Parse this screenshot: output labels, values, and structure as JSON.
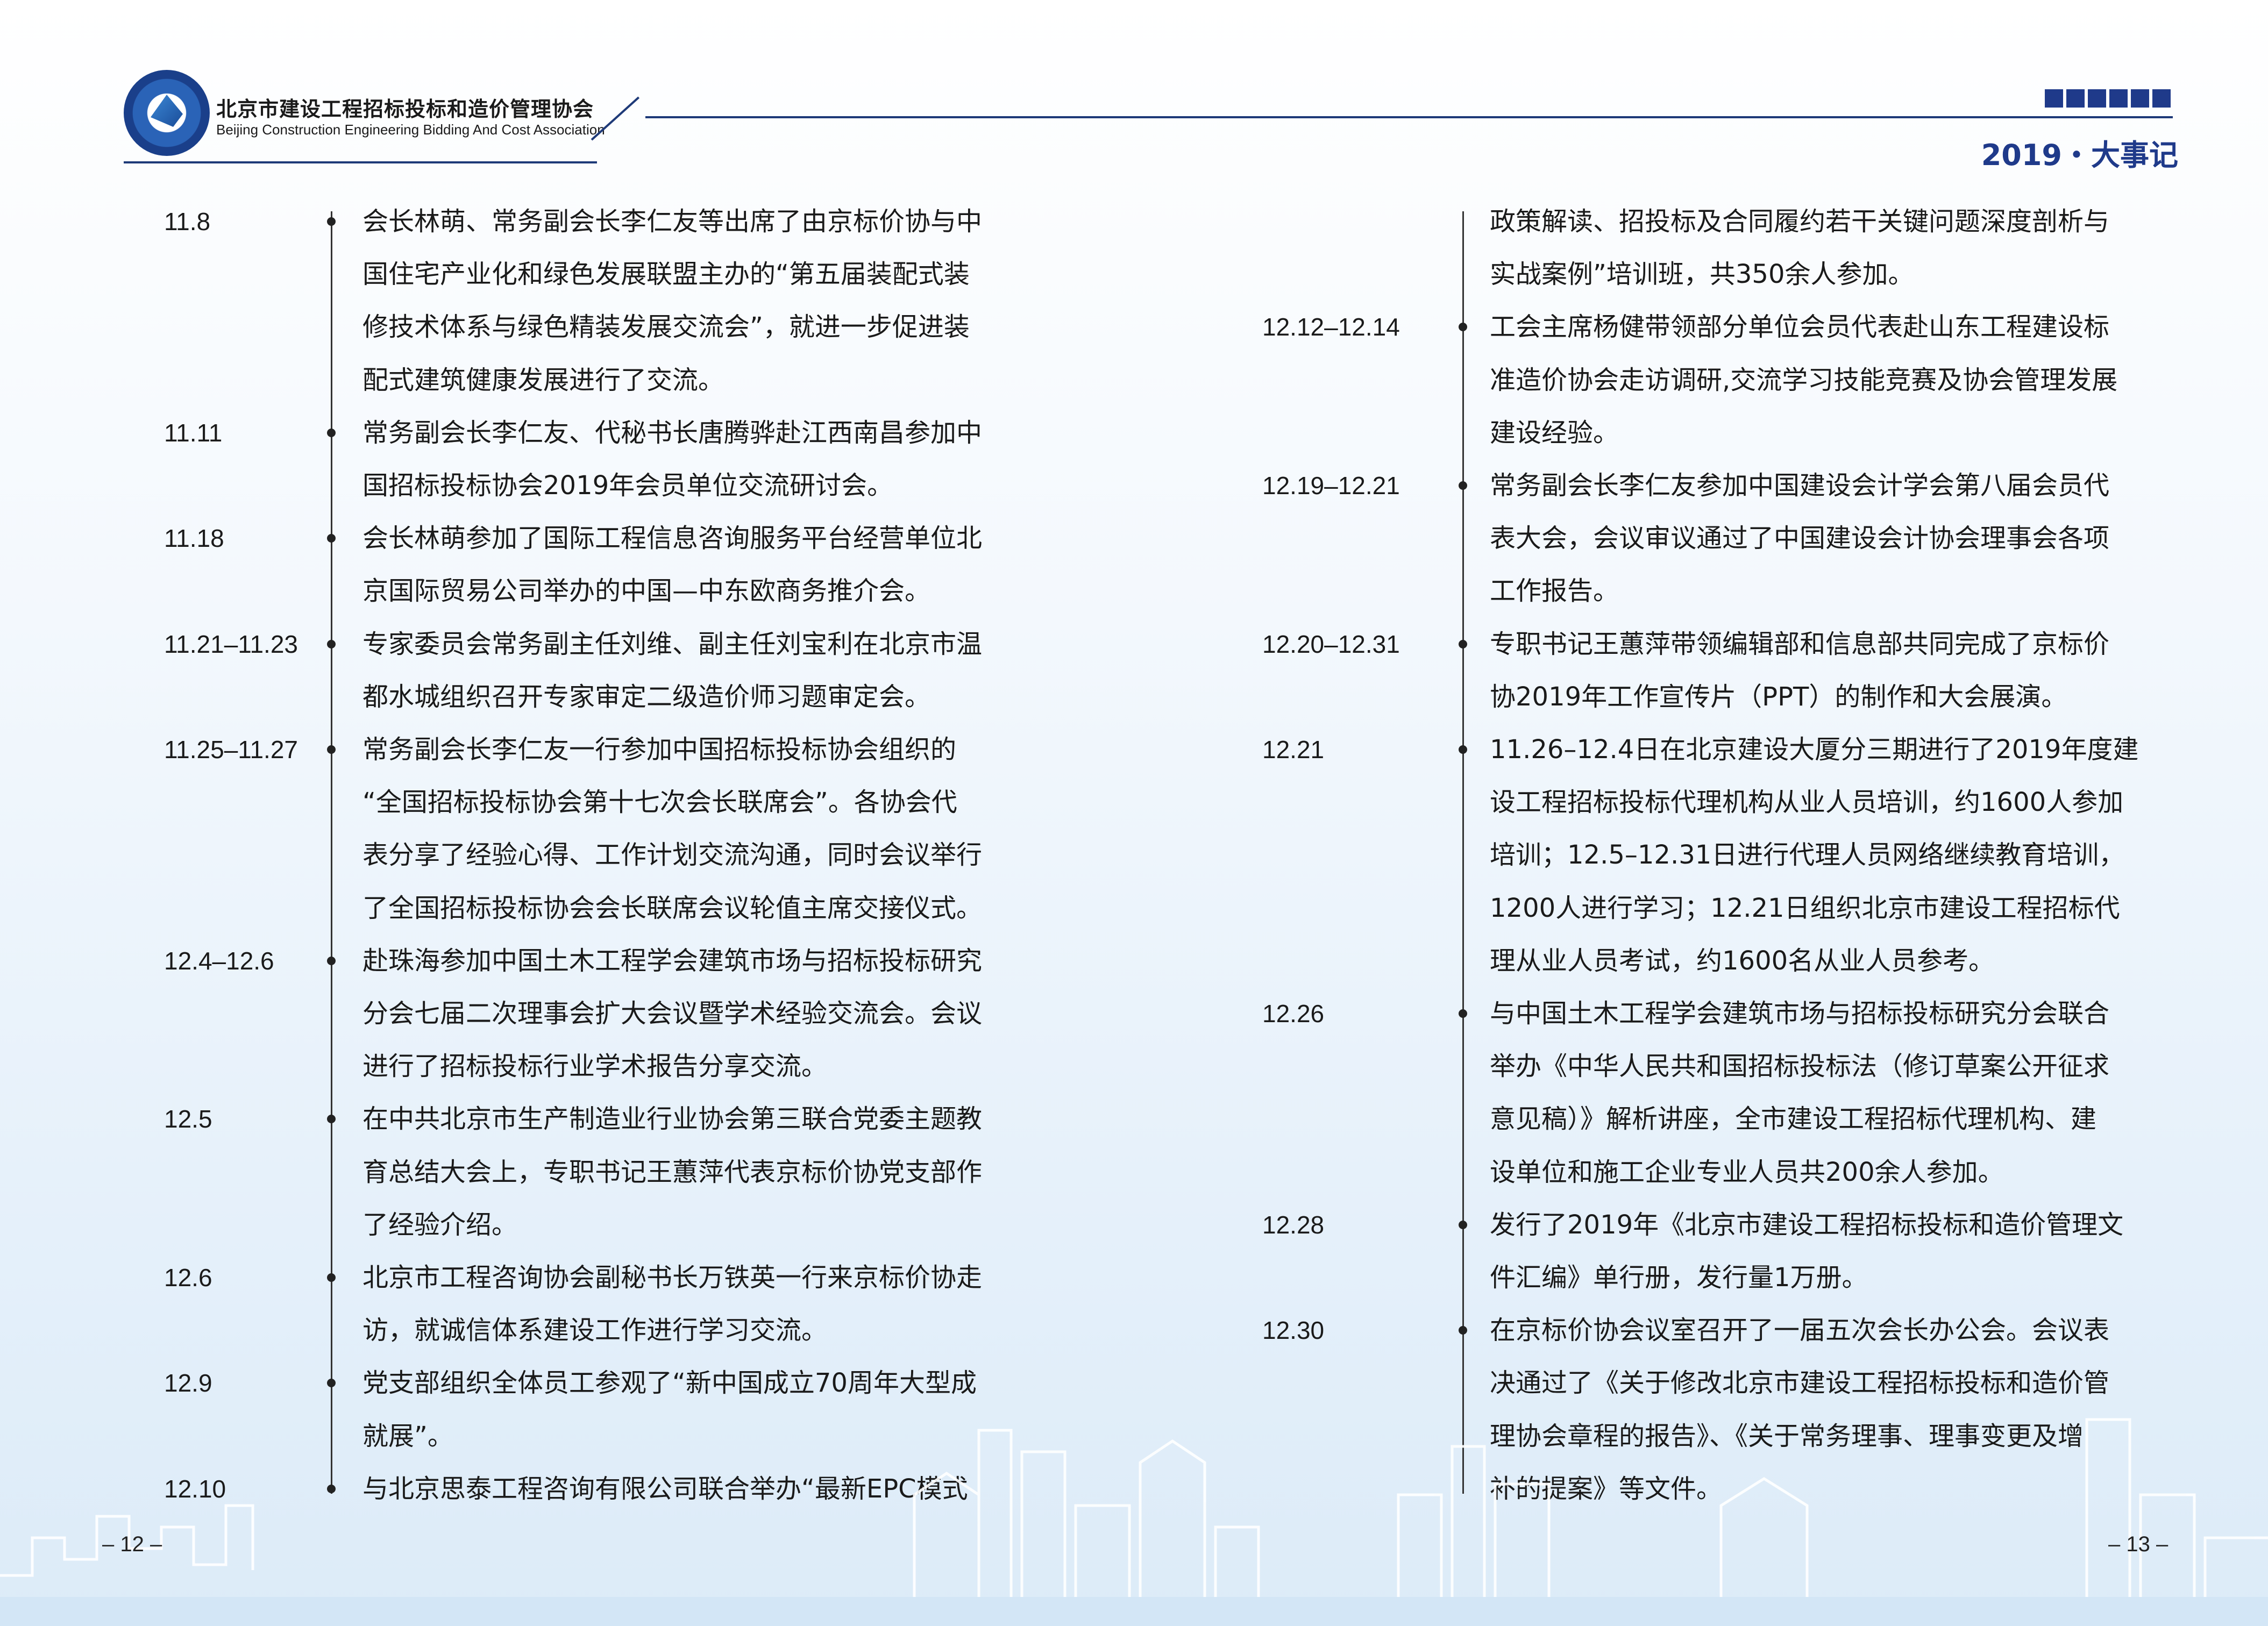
{
  "header": {
    "org_cn": "北京市建设工程招标投标和造价管理协会",
    "org_en": "Beijing Construction Engineering Bidding And Cost Association",
    "section_title": "2019・大事记"
  },
  "left_entries": [
    {
      "date": "11.8",
      "lines": [
        "会长林萌、常务副会长李仁友等出席了由京标价协与中",
        "国住宅产业化和绿色发展联盟主办的“第五届装配式装",
        "修技术体系与绿色精装发展交流会”，就进一步促进装",
        "配式建筑健康发展进行了交流。"
      ]
    },
    {
      "date": "11.11",
      "lines": [
        "常务副会长李仁友、代秘书长唐腾骅赴江西南昌参加中",
        "国招标投标协会2019年会员单位交流研讨会。"
      ]
    },
    {
      "date": "11.18",
      "lines": [
        "会长林萌参加了国际工程信息咨询服务平台经营单位北",
        "京国际贸易公司举办的中国—中东欧商务推介会。"
      ]
    },
    {
      "date": "11.21–11.23",
      "lines": [
        "专家委员会常务副主任刘维、副主任刘宝利在北京市温",
        "都水城组织召开专家审定二级造价师习题审定会。"
      ]
    },
    {
      "date": "11.25–11.27",
      "lines": [
        "常务副会长李仁友一行参加中国招标投标协会组织的",
        "“全国招标投标协会第十七次会长联席会”。各协会代",
        "表分享了经验心得、工作计划交流沟通，同时会议举行",
        "了全国招标投标协会会长联席会议轮值主席交接仪式。"
      ]
    },
    {
      "date": "12.4–12.6",
      "lines": [
        "赴珠海参加中国土木工程学会建筑市场与招标投标研究",
        "分会七届二次理事会扩大会议暨学术经验交流会。会议",
        "进行了招标投标行业学术报告分享交流。"
      ]
    },
    {
      "date": "12.5",
      "lines": [
        "在中共北京市生产制造业行业协会第三联合党委主题教",
        "育总结大会上，专职书记王蕙萍代表京标价协党支部作",
        "了经验介绍。"
      ]
    },
    {
      "date": "12.6",
      "lines": [
        "北京市工程咨询协会副秘书长万铁英一行来京标价协走",
        "访，就诚信体系建设工作进行学习交流。"
      ]
    },
    {
      "date": "12.9",
      "lines": [
        "党支部组织全体员工参观了“新中国成立70周年大型成",
        "就展”。"
      ]
    },
    {
      "date": "12.10",
      "lines": [
        "与北京思泰工程咨询有限公司联合举办“最新EPC模式"
      ]
    }
  ],
  "right_entries": [
    {
      "date": "",
      "lines": [
        "政策解读、招投标及合同履约若干关键问题深度剖析与",
        "实战案例”培训班，共350余人参加。"
      ]
    },
    {
      "date": "12.12–12.14",
      "lines": [
        "工会主席杨健带领部分单位会员代表赴山东工程建设标",
        "准造价协会走访调研,交流学习技能竞赛及协会管理发展",
        "建设经验。"
      ]
    },
    {
      "date": "12.19–12.21",
      "lines": [
        "常务副会长李仁友参加中国建设会计学会第八届会员代",
        "表大会，会议审议通过了中国建设会计协会理事会各项",
        "工作报告。"
      ]
    },
    {
      "date": "12.20–12.31",
      "lines": [
        "专职书记王蕙萍带领编辑部和信息部共同完成了京标价",
        "协2019年工作宣传片（PPT）的制作和大会展演。"
      ]
    },
    {
      "date": "12.21",
      "lines": [
        "11.26–12.4日在北京建设大厦分三期进行了2019年度建",
        "设工程招标投标代理机构从业人员培训，约1600人参加",
        "培训；12.5–12.31日进行代理人员网络继续教育培训，",
        "1200人进行学习；12.21日组织北京市建设工程招标代",
        "理从业人员考试，约1600名从业人员参考。"
      ]
    },
    {
      "date": "12.26",
      "lines": [
        "与中国土木工程学会建筑市场与招标投标研究分会联合",
        "举办《中华人民共和国招标投标法（修订草案公开征求",
        "意见稿）》解析讲座，全市建设工程招标代理机构、建",
        "设单位和施工企业专业人员共200余人参加。"
      ]
    },
    {
      "date": "12.28",
      "lines": [
        "发行了2019年《北京市建设工程招标投标和造价管理文",
        "件汇编》单行册，发行量1万册。"
      ]
    },
    {
      "date": "12.30",
      "lines": [
        "在京标价协会议室召开了一届五次会长办公会。会议表",
        "决通过了《关于修改北京市建设工程招标投标和造价管",
        "理协会章程的报告》、《关于常务理事、理事变更及增",
        "补的提案》等文件。"
      ]
    }
  ],
  "footer": {
    "page_left": "– 12 –",
    "page_right": "– 13 –"
  }
}
